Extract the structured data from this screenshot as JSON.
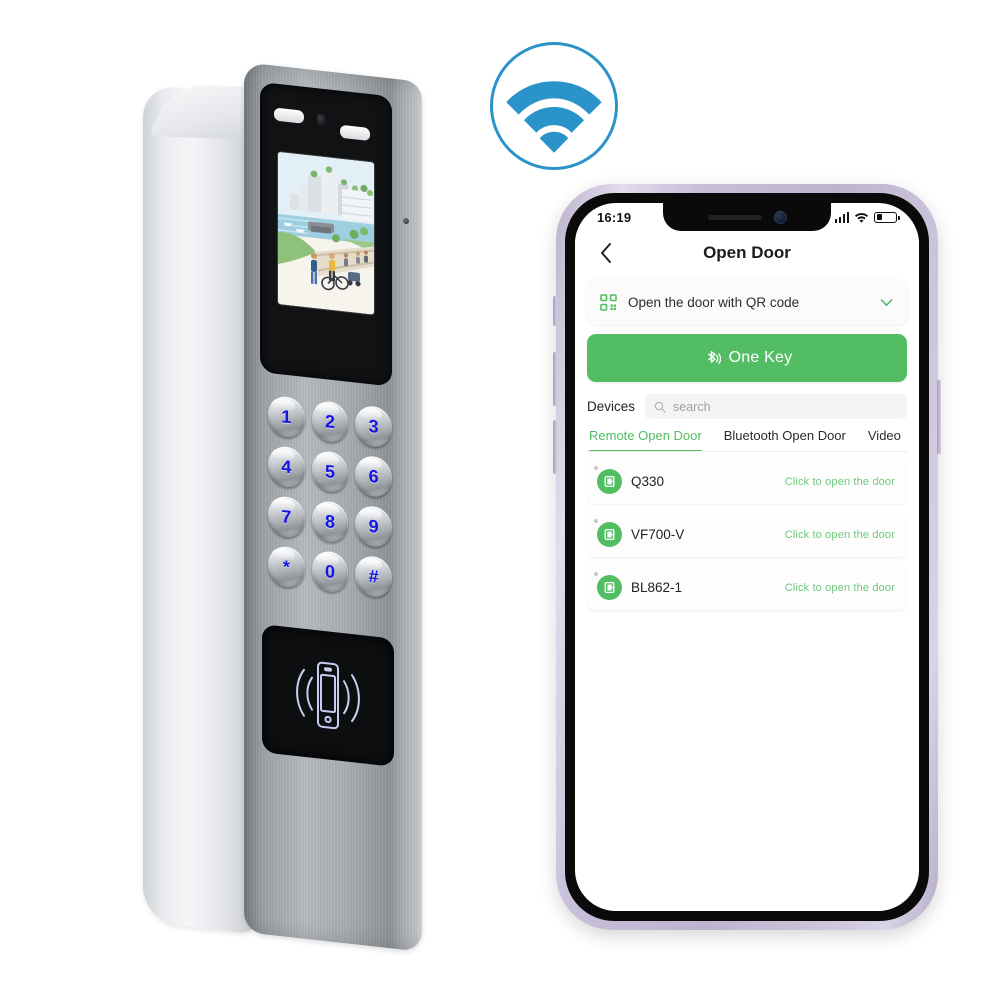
{
  "scene": {
    "wifi_badge": {
      "icon": "wifi-icon",
      "color": "#2a93c9"
    }
  },
  "terminal": {
    "name": "face-recognition-access-control-terminal",
    "lcd_scene": "city-waterfront-illustration",
    "keypad": [
      {
        "label": "1"
      },
      {
        "label": "2"
      },
      {
        "label": "3"
      },
      {
        "label": "4"
      },
      {
        "label": "5"
      },
      {
        "label": "6"
      },
      {
        "label": "7"
      },
      {
        "label": "8"
      },
      {
        "label": "9"
      },
      {
        "label": "*"
      },
      {
        "label": "0"
      },
      {
        "label": "#"
      }
    ],
    "key_color": "#1414e6",
    "rfid_icon": "nfc-card-reader-icon"
  },
  "phone": {
    "frame_color": "#c7bed8",
    "status_bar": {
      "time": "16:19",
      "signal_icon": "cellular-signal-icon",
      "wifi_icon": "wifi-status-icon",
      "battery_icon": "battery-icon"
    },
    "nav": {
      "back_icon": "chevron-left-icon",
      "title": "Open Door"
    },
    "qr_row": {
      "icon": "qr-code-icon",
      "label": "Open the door with QR code",
      "chevron_icon": "chevron-down-icon"
    },
    "one_key": {
      "icon": "bluetooth-icon",
      "label": "One Key",
      "color": "#52bd62"
    },
    "devices_header": {
      "title": "Devices",
      "search_icon": "search-icon",
      "search_placeholder": "search"
    },
    "tabs": [
      {
        "label": "Remote Open Door",
        "active": true
      },
      {
        "label": "Bluetooth Open Door",
        "active": false
      },
      {
        "label": "Video",
        "active": false
      }
    ],
    "devices": [
      {
        "name": "Q330",
        "action": "Click to open the door",
        "icon": "door-icon"
      },
      {
        "name": "VF700-V",
        "action": "Click to open the door",
        "icon": "door-icon"
      },
      {
        "name": "BL862-1",
        "action": "Click to open the door",
        "icon": "door-icon"
      }
    ]
  }
}
